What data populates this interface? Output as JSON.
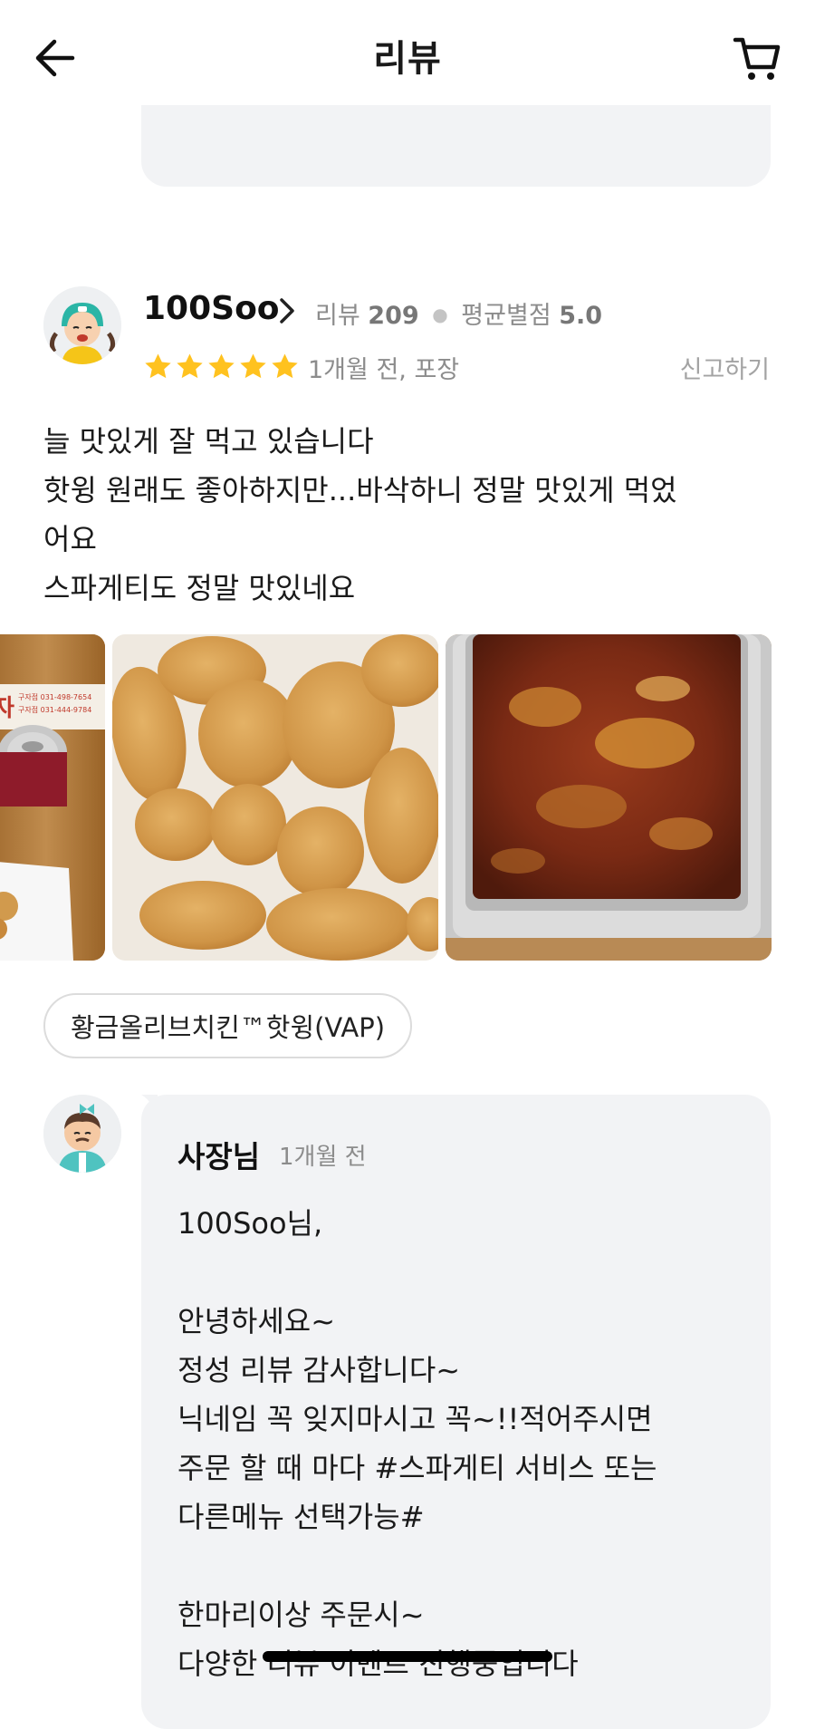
{
  "header": {
    "title": "리뷰",
    "back_icon": "arrow-left-icon",
    "cart_icon": "cart-icon"
  },
  "review": {
    "reviewer_name": "100Soo",
    "stats": {
      "review_label": "리뷰",
      "review_count": "209",
      "rating_label": "평균별점",
      "rating_value": "5.0"
    },
    "star_rating": 5,
    "meta": "1개월 전, 포장",
    "report_label": "신고하기",
    "body": [
      "늘 맛있게 잘 먹고 있습니다",
      "핫윙 원래도 좋아하지만...바삭하니 정말 맛있게 먹었",
      "어요",
      "스파게티도 정말 맛있네요"
    ],
    "photos": [
      {
        "label": "can-and-box-photo",
        "can_text": [
          "구자점 031-498-7654",
          "구자점 031-444-9784"
        ],
        "sign_text": "자"
      },
      {
        "label": "fried-wings-photo"
      },
      {
        "label": "baked-spaghetti-photo"
      }
    ],
    "menu_tag": "황금올리브치킨™핫윙(VAP)"
  },
  "owner_reply": {
    "name": "사장님",
    "time": "1개월 전",
    "lines": [
      "100Soo님,",
      "",
      "안녕하세요~",
      "정성 리뷰 감사합니다~",
      "닉네임 꼭 잊지마시고 꼭~!!적어주시면",
      "주문 할 때 마다 #스파게티 서비스 또는",
      "다른메뉴 선택가능#",
      "",
      "한마리이상 주문시~",
      "다양한 리뷰 이벤트 진행중입니다"
    ]
  },
  "colors": {
    "star": "#FFC21F",
    "bubble": "#F2F3F5",
    "muted_text": "#8C8C8C"
  }
}
